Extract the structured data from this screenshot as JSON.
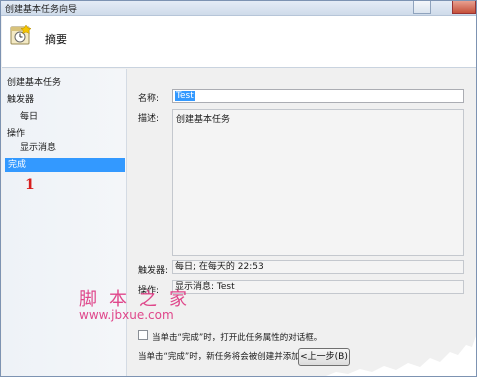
{
  "window": {
    "title": "创建基本任务向导"
  },
  "header": {
    "title": "摘要",
    "icon": "task-clock-icon"
  },
  "sidebar": {
    "items": [
      {
        "label": "创建基本任务",
        "level": 0,
        "active": false
      },
      {
        "label": "触发器",
        "level": 0,
        "active": false
      },
      {
        "label": "每日",
        "level": 1,
        "active": false
      },
      {
        "label": "操作",
        "level": 0,
        "active": false
      },
      {
        "label": "显示消息",
        "level": 1,
        "active": false
      },
      {
        "label": "完成",
        "level": 0,
        "active": true
      }
    ]
  },
  "annotation": {
    "step_number": "1"
  },
  "summary": {
    "name_label": "名称:",
    "name_value": "Test",
    "description_label": "描述:",
    "description_value": "创建基本任务",
    "trigger_label": "触发器:",
    "trigger_value": "每日; 在每天的 22:53",
    "action_label": "操作:",
    "action_value": "显示消息: Test",
    "open_properties_note": "当单击“完成”时，打开此任务属性的对话框。",
    "finish_note": "当单击“完成”时，新任务将会被创建并添加到 Windo"
  },
  "buttons": {
    "back_label": "<上一步(B)"
  },
  "watermark": {
    "text": "脚本之家",
    "url": "www.jbxue.com"
  },
  "colors": {
    "selection": "#3399ff",
    "annotation": "#d81e1e",
    "watermark": "#dc2878"
  }
}
